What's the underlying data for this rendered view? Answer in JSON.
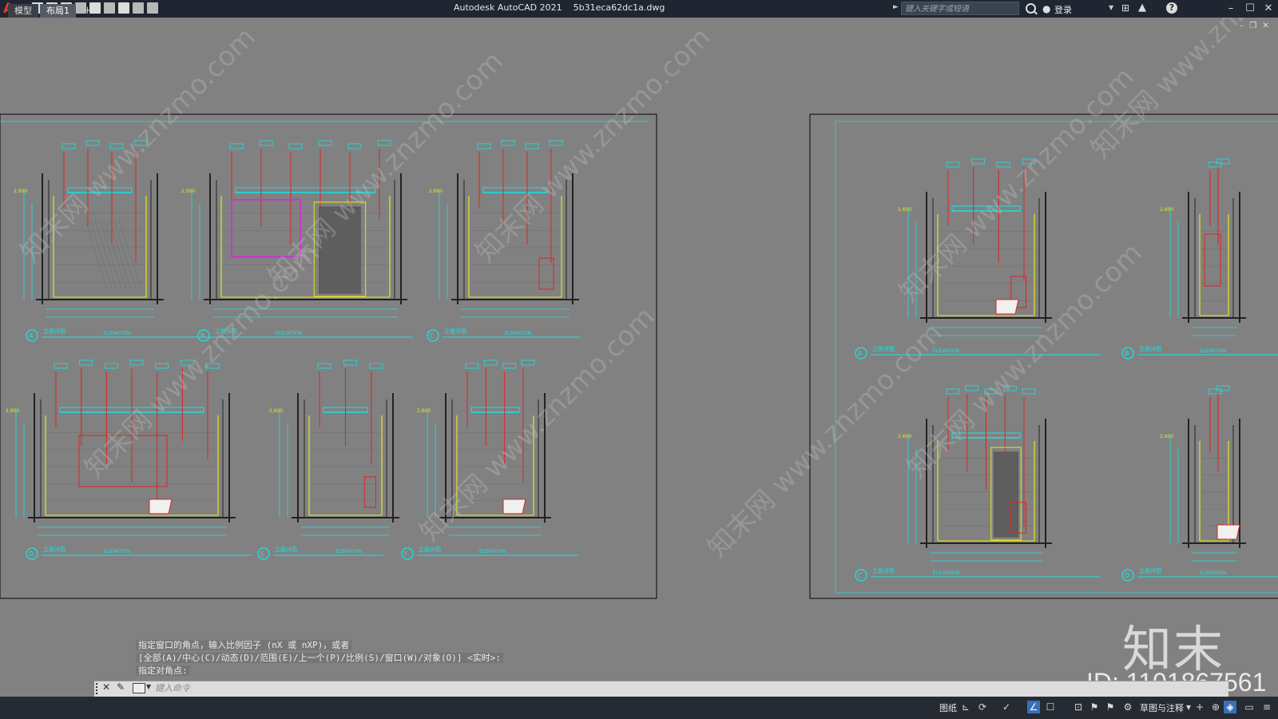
{
  "window": {
    "app_title": "Autodesk AutoCAD 2021",
    "file_name": "5b31eca62dc1a.dwg",
    "search_placeholder": "键入关键字或短语",
    "login_label": "登录",
    "min_glyph": "–",
    "max_glyph": "☐",
    "close_glyph": "✕",
    "logo_glyph": "A"
  },
  "doc_controls": {
    "min": "–",
    "restore": "❐",
    "close": "✕"
  },
  "drawing": {
    "sheet_left": {
      "elevations": [
        {
          "letter": "A",
          "title": "立面详图",
          "sub": "ELEVATION",
          "height_mark": "2,600"
        },
        {
          "letter": "B",
          "title": "立面详图",
          "sub": "ELEVATION",
          "height_mark": "2,600"
        },
        {
          "letter": "C",
          "title": "立面详图",
          "sub": "ELEVATION",
          "height_mark": "2,600"
        },
        {
          "letter": "D",
          "title": "立面详图",
          "sub": "ELEVATION",
          "height_mark": "2,600"
        },
        {
          "letter": "E",
          "title": "立面详图",
          "sub": "ELEVATION",
          "height_mark": "2,600"
        },
        {
          "letter": "F",
          "title": "立面详图",
          "sub": "ELEVATION",
          "height_mark": "2,600"
        }
      ]
    },
    "sheet_right": {
      "elevations": [
        {
          "letter": "A",
          "title": "立面详图",
          "sub": "ELEVATION",
          "height_mark": "2,600"
        },
        {
          "letter": "B",
          "title": "立面详图",
          "sub": "ELEVATION",
          "height_mark": "2,600"
        },
        {
          "letter": "C",
          "title": "立面详图",
          "sub": "ELEVATION",
          "height_mark": "2,600"
        },
        {
          "letter": "D",
          "title": "立面详图",
          "sub": "ELEVATION",
          "height_mark": "2,600"
        }
      ]
    },
    "watermark_text": "知末网 www.znzmo.com"
  },
  "command": {
    "history": [
      "指定窗口的角点，输入比例因子 (nX 或 nXP)，或者",
      "[全部(A)/中心(C)/动态(D)/范围(E)/上一个(P)/比例(S)/窗口(W)/对象(O)] <实时>:",
      "指定对角点:"
    ],
    "input_placeholder": "键入命令"
  },
  "watermark": {
    "logo": "知末",
    "id": "ID: 1101867561"
  },
  "status": {
    "tabs": [
      "模型",
      "布局1"
    ],
    "add_tab": "+",
    "paper_label": "图纸",
    "annotation_label": "草图与注释"
  },
  "colors": {
    "canvas": "#818181",
    "cyan": "#19e3e3",
    "red": "#e02222",
    "yellow": "#e6e61e",
    "magenta": "#e020e0",
    "titlebar": "#1f2631"
  }
}
